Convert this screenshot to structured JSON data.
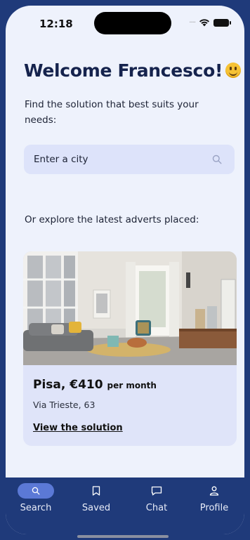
{
  "status_bar": {
    "time": "12:18"
  },
  "header": {
    "welcome_text": "Welcome Francesco!",
    "emoji_icon": "smiling-face-emoji"
  },
  "subtitle": "Find the solution that best suits your needs:",
  "search": {
    "placeholder": "Enter a city",
    "icon": "search-icon"
  },
  "explore_text": "Or explore the latest adverts placed:",
  "advert": {
    "city_price": "Pisa, €410",
    "price_period": "per month",
    "address": "Via Trieste, 63",
    "link_label": "View the solution"
  },
  "nav": {
    "items": [
      {
        "label": "Search",
        "icon": "search-icon",
        "active": true
      },
      {
        "label": "Saved",
        "icon": "bookmark-icon",
        "active": false
      },
      {
        "label": "Chat",
        "icon": "chat-bubble-icon",
        "active": false
      },
      {
        "label": "Profile",
        "icon": "person-icon",
        "active": false
      }
    ]
  },
  "colors": {
    "nav_background": "#1f3a7a",
    "title": "#15234d",
    "active_pill": "#5b79d6",
    "card_background": "#dfe4f9"
  }
}
